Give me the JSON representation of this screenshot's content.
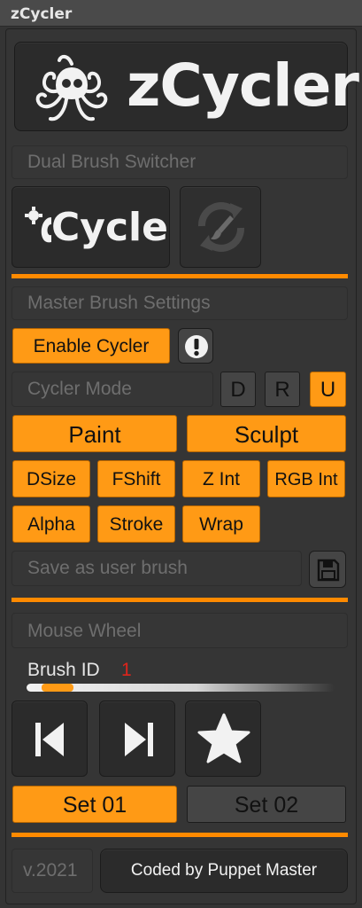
{
  "window": {
    "title": "zCycler"
  },
  "logo": {
    "text": "zCycler",
    "icon": "octopus-icon"
  },
  "dual": {
    "section_label": "Dual Brush Switcher",
    "cycle_label": "Cycle",
    "switch_icon": "brush-refresh-icon"
  },
  "master": {
    "section_label": "Master Brush Settings",
    "enable_label": "Enable Cycler",
    "warning_icon": "exclamation-icon",
    "mode_label": "Cycler Mode",
    "mode_buttons": [
      "D",
      "R",
      "U"
    ],
    "mode_selected": "U",
    "paint_label": "Paint",
    "sculpt_label": "Sculpt",
    "options": [
      "DSize",
      "FShift",
      "Z Int",
      "RGB Int",
      "Alpha",
      "Stroke",
      "Wrap"
    ],
    "save_label": "Save as user brush",
    "save_icon": "floppy-disk-icon"
  },
  "wheel": {
    "section_label": "Mouse Wheel",
    "brush_id_label": "Brush ID",
    "brush_id_value": "1",
    "slider_fraction": 0.1,
    "set1_label": "Set 01",
    "set2_label": "Set 02",
    "selected_set": "Set 01"
  },
  "footer": {
    "version": "v.2021",
    "credit": "Coded by Puppet Master"
  },
  "colors": {
    "accent": "#ff9a15",
    "accent_line": "#ff8a00",
    "background": "#353535",
    "brush_id_value": "#e0241b"
  }
}
